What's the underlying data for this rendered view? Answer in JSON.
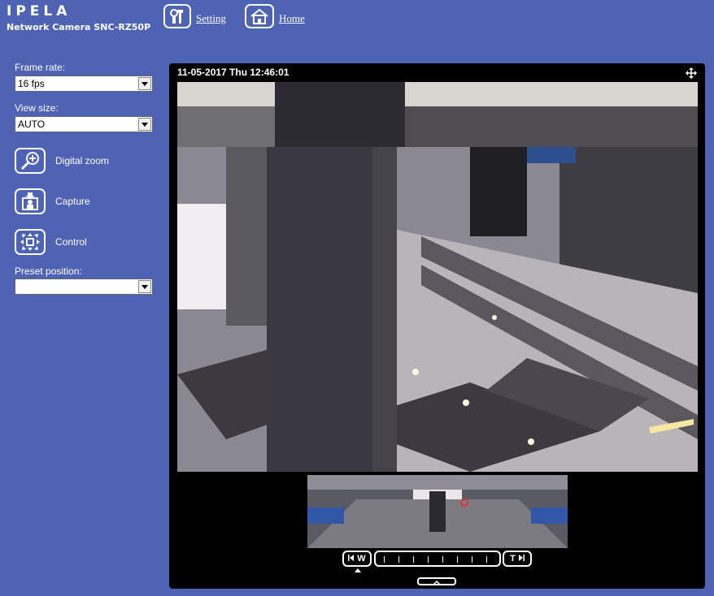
{
  "brand": {
    "logo": "IPELA",
    "model": "Network Camera SNC-RZ50P"
  },
  "topnav": {
    "setting": {
      "label": "Setting",
      "icon": "tools-icon"
    },
    "home": {
      "label": "Home",
      "icon": "home-icon"
    }
  },
  "sidebar": {
    "frame_rate": {
      "label": "Frame rate:",
      "value": "16 fps"
    },
    "view_size": {
      "label": "View size:",
      "value": "AUTO"
    },
    "tools": [
      {
        "label": "Digital zoom",
        "icon": "magnifier-plus-icon"
      },
      {
        "label": "Capture",
        "icon": "camera-capture-icon"
      },
      {
        "label": "Control",
        "icon": "pan-control-icon"
      }
    ],
    "preset": {
      "label": "Preset position:",
      "value": ""
    }
  },
  "viewer": {
    "timestamp": "11-05-2017 Thu 12:46:01",
    "zoom": {
      "wide_label": "W",
      "tele_label": "T"
    }
  },
  "colors": {
    "background": "#4f63b4",
    "viewer": "#000000"
  }
}
